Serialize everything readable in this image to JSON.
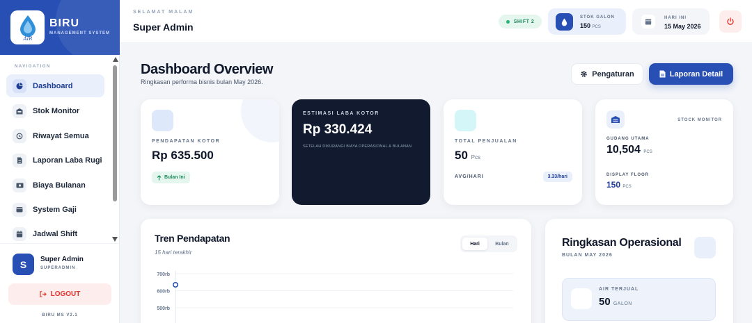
{
  "brand": {
    "name": "BIRU",
    "subtitle": "MANAGEMENT SYSTEM"
  },
  "nav": {
    "section_label": "NAVIGATION",
    "items": [
      {
        "label": "Dashboard",
        "icon": "pie-chart-icon",
        "active": true
      },
      {
        "label": "Stok Monitor",
        "icon": "warehouse-icon"
      },
      {
        "label": "Riwayat Semua",
        "icon": "history-icon"
      },
      {
        "label": "Laporan Laba Rugi",
        "icon": "file-icon"
      },
      {
        "label": "Biaya Bulanan",
        "icon": "money-icon"
      },
      {
        "label": "System Gaji",
        "icon": "wallet-icon"
      },
      {
        "label": "Jadwal Shift",
        "icon": "calendar-icon"
      }
    ]
  },
  "user": {
    "initial": "S",
    "name": "Super Admin",
    "role": "SUPERADMIN",
    "logout_label": "LOGOUT",
    "version": "BIRU MS V2.1"
  },
  "topbar": {
    "greeting": "SELAMAT MALAM",
    "name": "Super Admin",
    "shift_label": "SHIFT 2",
    "stok_label": "STOK GALON",
    "stok_value": "150",
    "stok_unit": "PCS",
    "date_label": "HARI INI",
    "date_value": "15 May 2026"
  },
  "header": {
    "title": "Dashboard Overview",
    "subtitle": "Ringkasan performa bisnis bulan May 2026.",
    "settings_label": "Pengaturan",
    "report_label": "Laporan Detail"
  },
  "cards": {
    "gross": {
      "label": "PENDAPATAN KOTOR",
      "value": "Rp 635.500",
      "badge": "Bulan Ini"
    },
    "profit": {
      "label": "ESTIMASI LABA KOTOR",
      "value": "Rp 330.424",
      "note": "SETELAH DIKURANGI BIAYA OPERASIONAL & BULANAN"
    },
    "sales": {
      "label": "TOTAL PENJUALAN",
      "value": "50",
      "unit": "Pcs",
      "avg_label": "AVG/HARI",
      "avg_value": "3.33/hari"
    },
    "stock": {
      "title": "STOCK MONITOR",
      "main_label": "GUDANG UTAMA",
      "main_value": "10,504",
      "main_unit": "PCS",
      "floor_label": "DISPLAY FLOOR",
      "floor_value": "150",
      "floor_unit": "PCS"
    }
  },
  "trend": {
    "title": "Tren Pendapatan",
    "subtitle": "15 hari terakhir",
    "toggle": [
      "Hari",
      "Bulan"
    ],
    "chart": {
      "y_ticks": [
        "700rb",
        "600rb",
        "500rb"
      ]
    }
  },
  "ops": {
    "title": "Ringkasan Operasional",
    "subtitle": "BULAN MAY 2026",
    "sold_label": "AIR TERJUAL",
    "sold_value": "50",
    "sold_unit": "GALON"
  },
  "colors": {
    "primary": "#2850b4",
    "dark": "#111a2e",
    "danger": "#e0352b",
    "success": "#22b573"
  }
}
